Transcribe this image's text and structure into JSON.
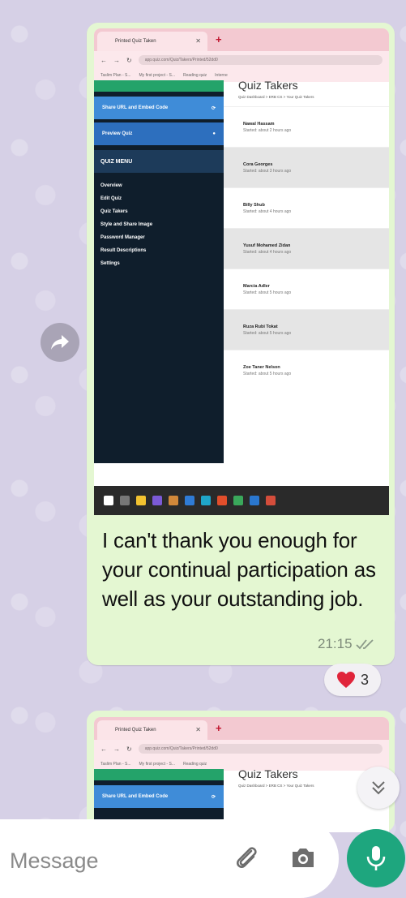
{
  "colors": {
    "bubble": "#e4f7d2",
    "accent": "#1ea67e",
    "reaction_heart": "#e0243a"
  },
  "browser": {
    "tab_title": "Printed Quiz Taken",
    "url": "app.quiz.com/Quiz/Takers/Printed/52dd0",
    "bookmarks": [
      "",
      "",
      "Taslim Plan - S...",
      "My first project - S...",
      "Reading quiz",
      "Interne"
    ]
  },
  "quiz_app": {
    "share_button": "Share URL and Embed Code",
    "preview_button": "Preview Quiz",
    "menu_title": "QUIZ MENU",
    "menu_items": [
      "Overview",
      "Edit Quiz",
      "Quiz Takers",
      "Style and Share Image",
      "Password Manager",
      "Result Descriptions",
      "Settings"
    ],
    "page_title": "Quiz Takers",
    "breadcrumb": "Quiz Dashboard > ERB CS > Your Quiz Takers",
    "takers": [
      {
        "name": "Nawal Hassam",
        "status": "Started: about 2 hours ago"
      },
      {
        "name": "Cora Georges",
        "status": "Started: about 3 hours ago"
      },
      {
        "name": "Billy Shub",
        "status": "Started: about 4 hours ago"
      },
      {
        "name": "Yusuf Mohamed Zidan",
        "status": "Started: about 4 hours ago"
      },
      {
        "name": "Marcia Adler",
        "status": "Started: about 5 hours ago"
      },
      {
        "name": "Ruza Rubi Tokat",
        "status": "Started: about 5 hours ago"
      },
      {
        "name": "Zoe Taner Nelson",
        "status": "Started: about 5 hours ago"
      }
    ]
  },
  "message": {
    "text": "I can't thank you enough for your continual participation as well as your outstanding job.",
    "time": "21:15",
    "reaction_count": "3"
  },
  "composer": {
    "placeholder": "Message"
  }
}
